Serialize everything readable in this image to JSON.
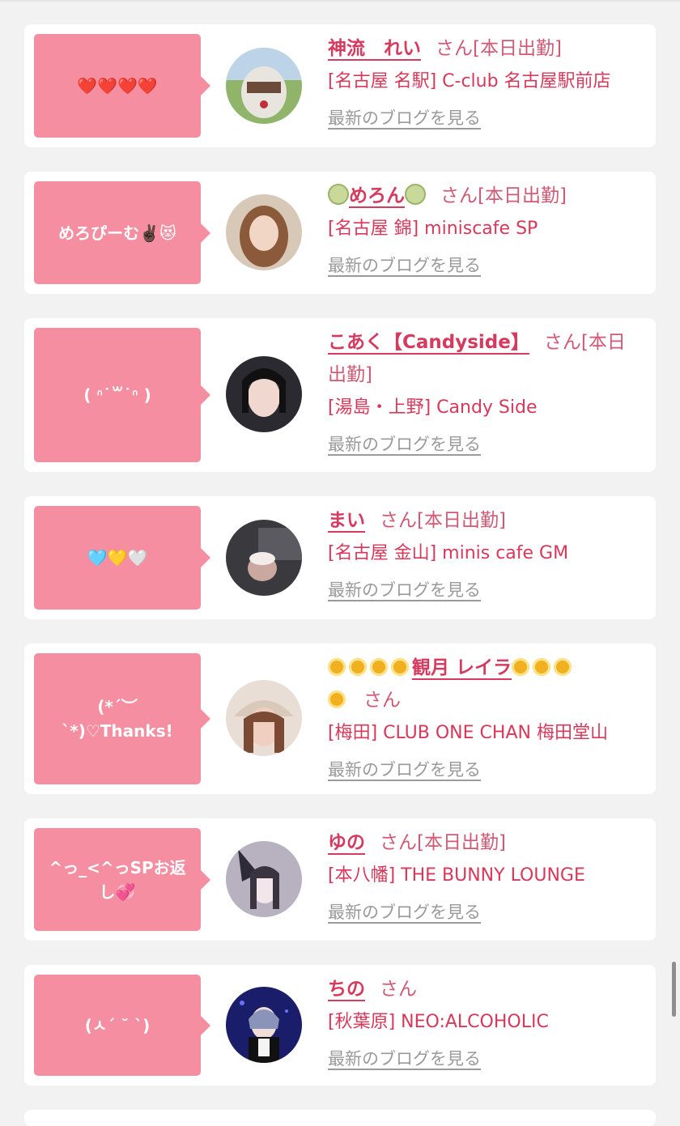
{
  "cards": [
    {
      "message": "❤️❤️❤️❤️",
      "name": "神流　れい",
      "name_suffix": "さん[本日出勤]",
      "shop": "[名古屋 名駅] C-club 名古屋駅前店",
      "blog_link": "最新のブログを見る"
    },
    {
      "message": "めろぴーむ✌🏿😻",
      "name": "めろん",
      "name_suffix": "さん[本日出勤]",
      "shop": "[名古屋 錦] miniscafe SP",
      "blog_link": "最新のブログを見る"
    },
    {
      "message": "( ᐢ˙꒳˙ᐢ )",
      "name": "こあく【Candyside】",
      "name_suffix": "さん[本日出勤]",
      "shop": "[湯島・上野] Candy Side",
      "blog_link": "最新のブログを見る"
    },
    {
      "message": "🩵💛🤍",
      "name": "まい",
      "name_suffix": "さん[本日出勤]",
      "shop": "[名古屋 金山] minis cafe GM",
      "blog_link": "最新のブログを見る"
    },
    {
      "message": "(*´︶`*)♡Thanks!",
      "name": "観月 レイラ",
      "name_suffix": "さん",
      "shop": "[梅田] CLUB ONE CHAN 梅田堂山",
      "blog_link": "最新のブログを見る"
    },
    {
      "message": "^っ_<^っSPお返し💞",
      "name": "ゆの",
      "name_suffix": "さん[本日出勤]",
      "shop": "[本八幡] THE BUNNY LOUNGE",
      "blog_link": "最新のブログを見る"
    },
    {
      "message": "(ㅅ´ ˘ `)",
      "name": "ちの",
      "name_suffix": "さん",
      "shop": "[秋葉原] NEO:ALCOHOLIC",
      "blog_link": "最新のブログを見る"
    }
  ]
}
